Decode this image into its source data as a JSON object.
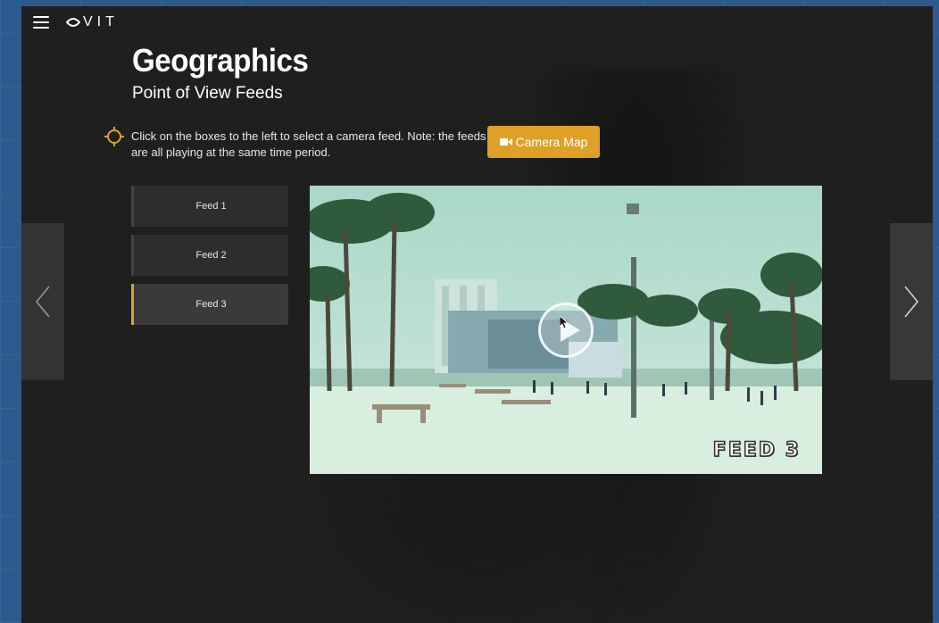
{
  "brand": {
    "logo_text": "VIT",
    "menu_icon": "hamburger-icon"
  },
  "page": {
    "title": "Geographics",
    "subtitle": "Point of View Feeds"
  },
  "instruction": {
    "icon": "crosshair-icon",
    "text": "Click on the boxes to the left to select a camera feed. Note: the feeds are all playing at the same time period."
  },
  "camera_map_button": {
    "icon": "video-camera-icon",
    "label": "Camera Map"
  },
  "feeds": [
    {
      "label": "Feed 1",
      "active": false
    },
    {
      "label": "Feed 2",
      "active": false
    },
    {
      "label": "Feed 3",
      "active": true
    }
  ],
  "video": {
    "overlay_label": "FEED 3",
    "play_icon": "play-icon"
  },
  "navigation": {
    "prev_icon": "chevron-left-icon",
    "next_icon": "chevron-right-icon"
  },
  "colors": {
    "accent": "#dfa028",
    "panel": "#1f1f1f",
    "outer": "#2c5a8e"
  }
}
